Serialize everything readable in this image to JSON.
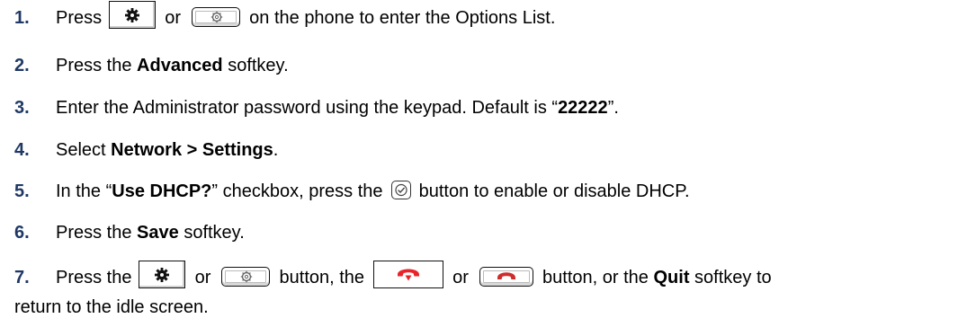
{
  "steps": [
    {
      "num": "1.",
      "a": "Press ",
      "b": " or ",
      "c": " on the phone to enter the Options List."
    },
    {
      "num": "2.",
      "a": "Press the ",
      "bold": "Advanced",
      "c": " softkey."
    },
    {
      "num": "3.",
      "a": "Enter the Administrator password using the keypad. Default is “",
      "bold": "22222",
      "c": "”."
    },
    {
      "num": "4.",
      "a": "Select ",
      "bold": "Network > Settings",
      "c": "."
    },
    {
      "num": "5.",
      "a": "In the “",
      "bold": "Use DHCP?",
      "b": "” checkbox, press the ",
      "c": " button to enable or disable DHCP."
    },
    {
      "num": "6.",
      "a": "Press the ",
      "bold": "Save",
      "c": " softkey."
    },
    {
      "num": "7.",
      "a": "Press the ",
      "b": " or ",
      "c": " button, the ",
      "d": " or ",
      "e": " button, or the ",
      "bold": "Quit",
      "f": " softkey to",
      "line2": "return to the idle screen."
    }
  ],
  "icons": {
    "options_key": "options-gear-icon",
    "settings_key": "settings-gear-icon",
    "confirm_key": "checkmark-icon",
    "onhook_red_key": "onhook-red-icon",
    "onhook_key": "onhook-handset-icon"
  },
  "colors": {
    "step_number": "#1f3864",
    "onhook_red": "#e8242b"
  }
}
